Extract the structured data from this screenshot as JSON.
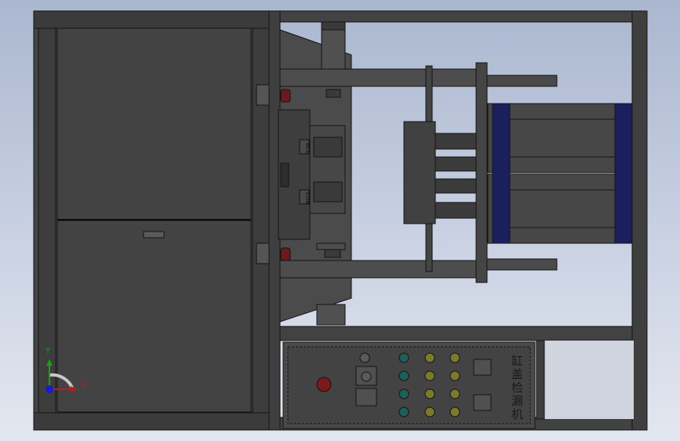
{
  "viewport": {
    "width": 867,
    "height": 562
  },
  "model": {
    "panel_title": "缸盖检漏机",
    "sensor_labels": [
      "BCE",
      "CDB"
    ]
  },
  "triad": {
    "x_label": "X",
    "y_label": "Y"
  },
  "colors": {
    "background_top": "#aab7cf",
    "background_bottom": "#e4e7ef",
    "frame": "#3c3c3c",
    "frame_edge": "#141414",
    "cylinder_band": "#1c1f5e",
    "indicator_green": "#1f5f5a",
    "indicator_yellow": "#7a7a2e",
    "estop_red": "#7a1a1a",
    "axis_x": "#c21818",
    "axis_y": "#17a317",
    "axis_z": "#1a1ad0"
  }
}
